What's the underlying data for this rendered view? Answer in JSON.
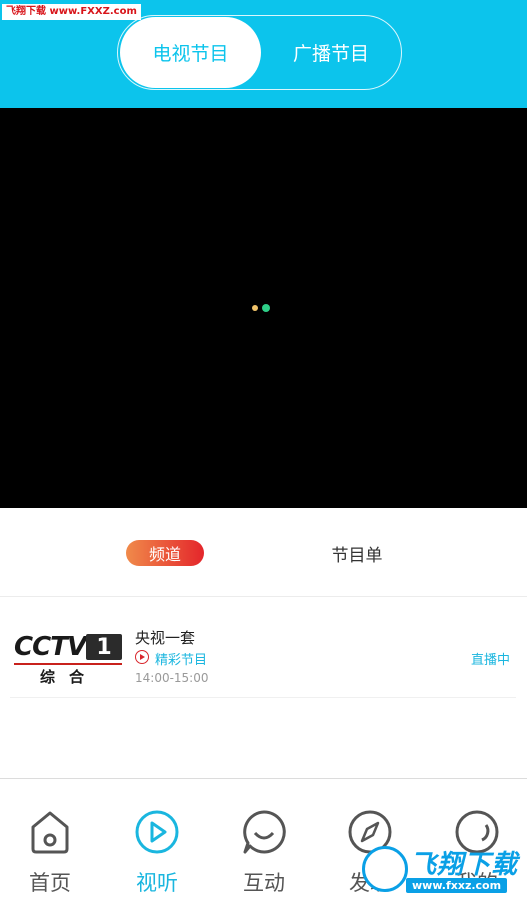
{
  "watermark": "飞翔下载 www.FXXZ.com",
  "header": {
    "tabs": [
      {
        "label": "电视节目",
        "active": true
      },
      {
        "label": "广播节目",
        "active": false
      }
    ],
    "accent": "#0cc4ec"
  },
  "player": {
    "background": "#000000"
  },
  "subtabs": [
    {
      "label": "频道",
      "active": true
    },
    {
      "label": "节目单",
      "active": false
    }
  ],
  "channels": [
    {
      "logo_text": "CCTV",
      "logo_number": "1",
      "logo_sub": "综合",
      "name": "央视一套",
      "program": "精彩节目",
      "time": "14:00-15:00",
      "status": "直播中"
    }
  ],
  "nav": [
    {
      "label": "首页",
      "icon": "home-icon",
      "active": false
    },
    {
      "label": "视听",
      "icon": "play-icon",
      "active": true
    },
    {
      "label": "互动",
      "icon": "chat-icon",
      "active": false
    },
    {
      "label": "发现",
      "icon": "compass-icon",
      "active": false
    },
    {
      "label": "我的",
      "icon": "profile-icon",
      "active": false
    }
  ],
  "badge": {
    "title": "飞翔下载",
    "url": "www.fxxz.com",
    "color": "#0aa0e6"
  }
}
